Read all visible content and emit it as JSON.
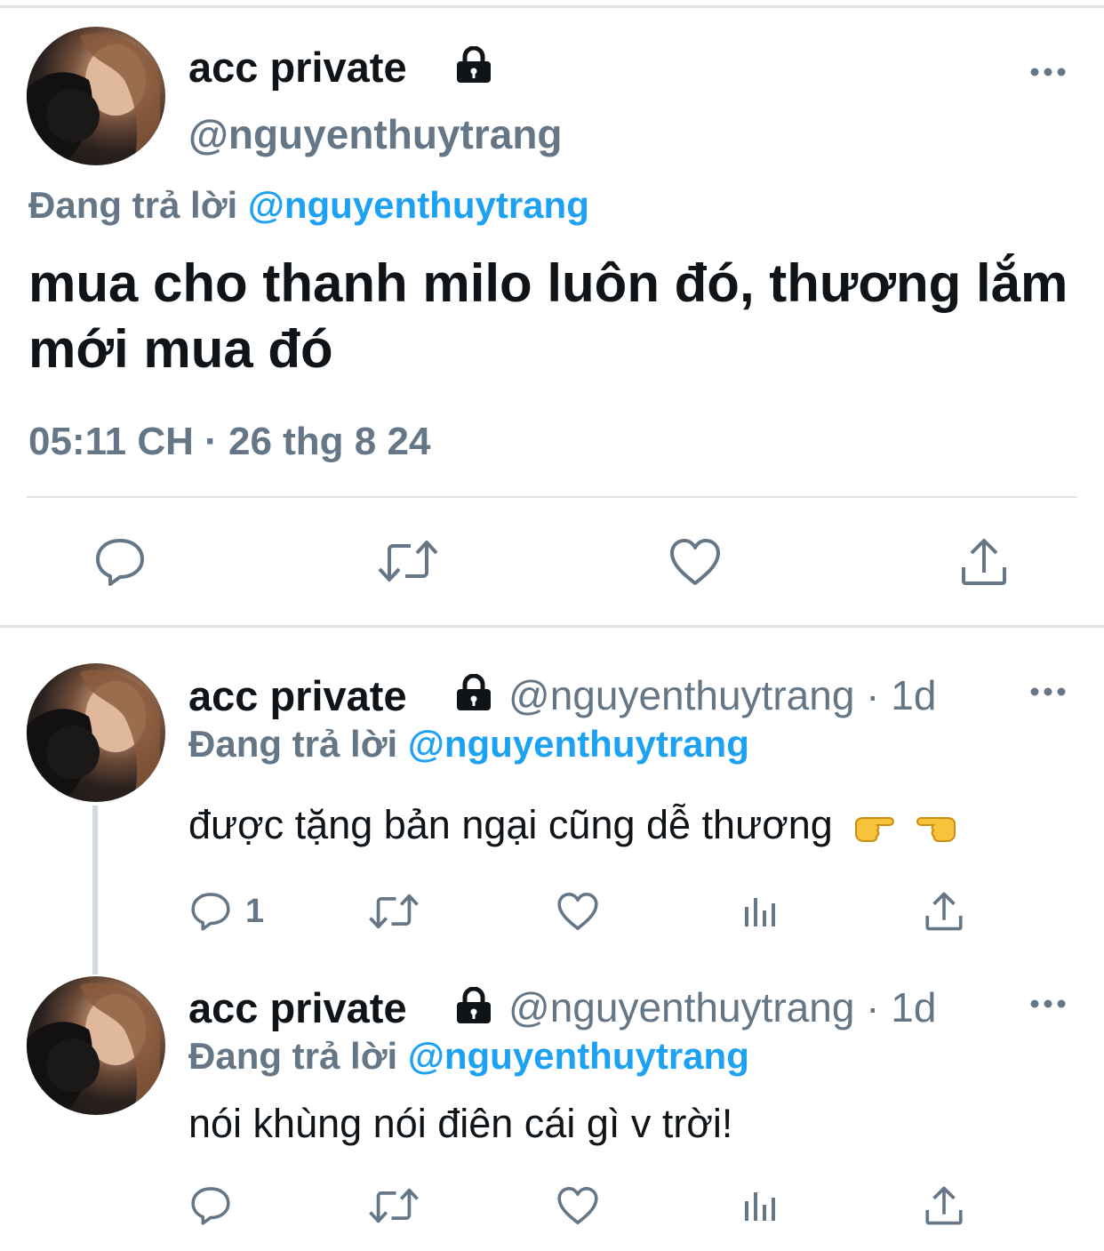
{
  "colors": {
    "accent": "#1da1f2",
    "muted": "#657786",
    "text": "#0f1419",
    "divider": "#e1e4e7"
  },
  "main_tweet": {
    "display_name": "acc private",
    "handle": "@nguyenthuytrang",
    "replying_prefix": "Đang trả lời",
    "replying_mention": "@nguyenthuytrang",
    "text": "mua cho thanh milo luôn đó, thương lắm mới mua đó",
    "timestamp": "05:11 CH · 26 thg 8 24",
    "icons": [
      "reply-icon",
      "retweet-icon",
      "like-icon",
      "share-icon"
    ]
  },
  "replies": [
    {
      "display_name": "acc private",
      "handle": "@nguyenthuytrang · 1d",
      "replying_prefix": "Đang trả lời",
      "replying_mention": "@nguyenthuytrang",
      "text": "được tặng bản ngại cũng dễ thương",
      "emojis": [
        "finger-pointing-right-icon",
        "finger-pointing-left-icon"
      ],
      "reply_count": "1"
    },
    {
      "display_name": "acc private",
      "handle": "@nguyenthuytrang · 1d",
      "replying_prefix": "Đang trả lời",
      "replying_mention": "@nguyenthuytrang",
      "text": "nói khùng nói điên cái gì v trời!",
      "reply_count": ""
    }
  ]
}
